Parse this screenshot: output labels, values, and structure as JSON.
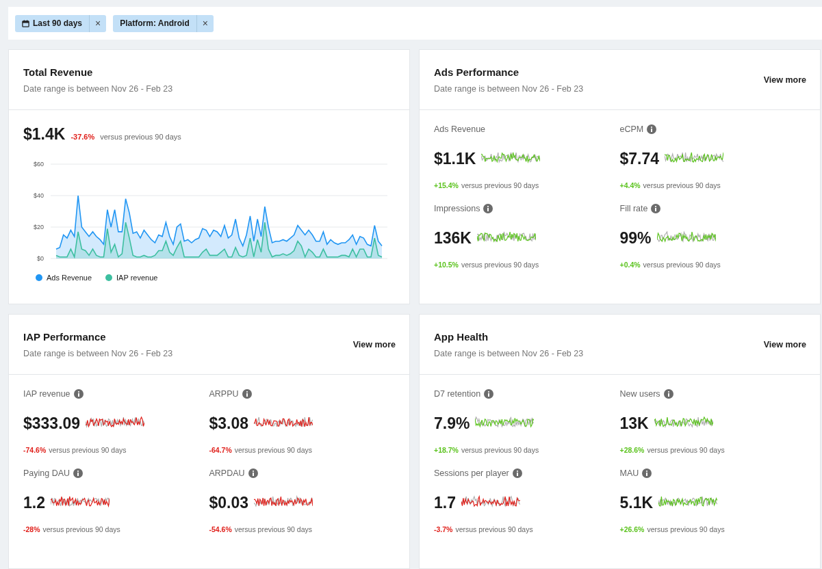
{
  "filters": [
    {
      "label": "Last 90 days",
      "icon": true,
      "remove": "×"
    },
    {
      "label": "Platform: Android",
      "icon": false,
      "remove": "×"
    }
  ],
  "total_revenue": {
    "title": "Total Revenue",
    "subtitle": "Date range is between Nov 26 - Feb 23",
    "value": "$1.4K",
    "delta": "-37.6%",
    "color": "#e0201b",
    "comparison": "versus previous 90 days",
    "chart_data": {
      "type": "area",
      "legend": "bottom",
      "yticks": [
        {
          "value": 0,
          "label": "$0"
        },
        {
          "value": 20,
          "label": "$20"
        },
        {
          "value": 40,
          "label": "$40"
        },
        {
          "value": 60,
          "label": "$60"
        }
      ],
      "ylim": [
        0,
        60
      ],
      "series": [
        {
          "name": "Ads Revenue",
          "color": "#2196f3",
          "values": [
            6,
            7,
            15,
            13,
            18,
            14,
            40,
            20,
            17,
            14,
            17,
            14,
            12,
            9,
            31,
            20,
            31,
            17,
            17,
            38,
            29,
            16,
            17,
            13,
            18,
            15,
            12,
            10,
            15,
            14,
            23,
            14,
            9,
            20,
            22,
            11,
            12,
            10,
            12,
            13,
            19,
            18,
            14,
            18,
            17,
            14,
            21,
            13,
            15,
            25,
            13,
            8,
            15,
            27,
            11,
            25,
            14,
            33,
            20,
            10,
            11,
            11,
            12,
            11,
            13,
            15,
            21,
            18,
            15,
            18,
            15,
            11,
            11,
            17,
            9,
            12,
            10,
            9,
            10,
            10,
            12,
            15,
            9,
            14,
            13,
            9,
            8,
            21,
            11,
            8
          ]
        },
        {
          "name": "IAP revenue",
          "color": "#3dbfa0",
          "values": [
            2,
            1,
            1,
            1,
            6,
            1,
            17,
            6,
            5,
            2,
            6,
            2,
            1,
            1,
            19,
            4,
            9,
            1,
            3,
            23,
            13,
            2,
            1,
            1,
            2,
            1,
            1,
            2,
            5,
            5,
            11,
            4,
            2,
            7,
            11,
            1,
            1,
            1,
            1,
            1,
            4,
            6,
            2,
            2,
            2,
            4,
            6,
            1,
            1,
            7,
            2,
            1,
            2,
            13,
            1,
            12,
            4,
            23,
            6,
            1,
            2,
            2,
            3,
            2,
            3,
            5,
            11,
            8,
            1,
            6,
            4,
            1,
            1,
            6,
            1,
            1,
            1,
            1,
            2,
            2,
            1,
            6,
            1,
            6,
            6,
            1,
            1,
            13,
            2,
            1
          ]
        }
      ]
    }
  },
  "sections": [
    {
      "title": "Ads Performance",
      "subtitle": "Date range is between Nov 26 - Feb 23",
      "link": "View more",
      "metrics": [
        {
          "label": "Ads Revenue",
          "info": false,
          "value": "$1.1K",
          "delta": "+15.4%",
          "color": "#5cc31f",
          "comparison": "versus previous 90 days"
        },
        {
          "label": "eCPM",
          "info": true,
          "value": "$7.74",
          "delta": "+4.4%",
          "color": "#5cc31f",
          "comparison": "versus previous 90 days"
        },
        {
          "label": "Impressions",
          "info": true,
          "value": "136K",
          "delta": "+10.5%",
          "color": "#5cc31f",
          "comparison": "versus previous 90 days"
        },
        {
          "label": "Fill rate",
          "info": true,
          "value": "99%",
          "delta": "+0.4%",
          "color": "#5cc31f",
          "comparison": "versus previous 90 days"
        }
      ]
    },
    {
      "title": "IAP Performance",
      "subtitle": "Date range is between Nov 26 - Feb 23",
      "link": "View more",
      "metrics": [
        {
          "label": "IAP revenue",
          "info": true,
          "value": "$333.09",
          "delta": "-74.6%",
          "color": "#e0201b",
          "comparison": "versus previous 90 days"
        },
        {
          "label": "ARPPU",
          "info": true,
          "value": "$3.08",
          "delta": "-64.7%",
          "color": "#e0201b",
          "comparison": "versus previous 90 days"
        },
        {
          "label": "Paying DAU",
          "info": true,
          "value": "1.2",
          "delta": "-28%",
          "color": "#e0201b",
          "comparison": "versus previous 90 days"
        },
        {
          "label": "ARPDAU",
          "info": true,
          "value": "$0.03",
          "delta": "-54.6%",
          "color": "#e0201b",
          "comparison": "versus previous 90 days"
        }
      ]
    },
    {
      "title": "App Health",
      "subtitle": "Date range is between Nov 26 - Feb 23",
      "link": "View more",
      "metrics": [
        {
          "label": "D7 retention",
          "info": true,
          "value": "7.9%",
          "delta": "+18.7%",
          "color": "#5cc31f",
          "comparison": "versus previous 90 days"
        },
        {
          "label": "New users",
          "info": true,
          "value": "13K",
          "delta": "+28.6%",
          "color": "#5cc31f",
          "comparison": "versus previous 90 days"
        },
        {
          "label": "Sessions per player",
          "info": true,
          "value": "1.7",
          "delta": "-3.7%",
          "color": "#e0201b",
          "comparison": "versus previous 90 days"
        },
        {
          "label": "MAU",
          "info": true,
          "value": "5.1K",
          "delta": "+26.6%",
          "color": "#5cc31f",
          "comparison": "versus previous 90 days"
        }
      ]
    }
  ]
}
